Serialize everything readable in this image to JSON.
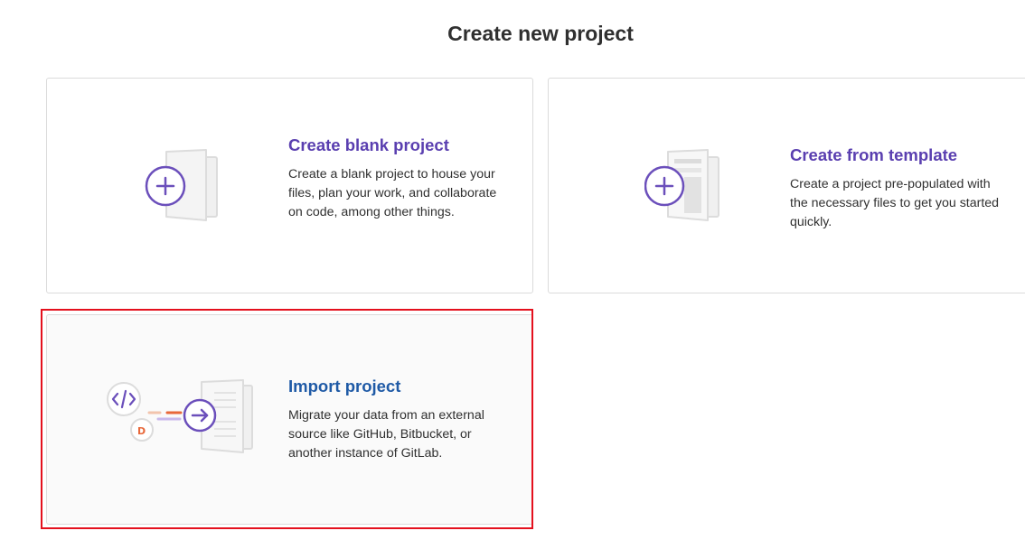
{
  "page": {
    "title": "Create new project"
  },
  "cards": {
    "blank": {
      "title": "Create blank project",
      "description": "Create a blank project to house your files, plan your work, and collaborate on code, among other things.",
      "icon": "plus-document-icon"
    },
    "template": {
      "title": "Create from template",
      "description": "Create a project pre-populated with the necessary files to get you started quickly.",
      "icon": "template-document-icon"
    },
    "import": {
      "title": "Import project",
      "description": "Migrate your data from an external source like GitHub, Bitbucket, or another instance of GitLab.",
      "icon": "import-document-icon",
      "selected": true
    }
  },
  "colors": {
    "accent_purple": "#6b4fbb",
    "title_purple": "#5a3fb0",
    "title_blue": "#1f5aa6",
    "highlight_red": "#e4101d",
    "orange": "#e8683a"
  }
}
